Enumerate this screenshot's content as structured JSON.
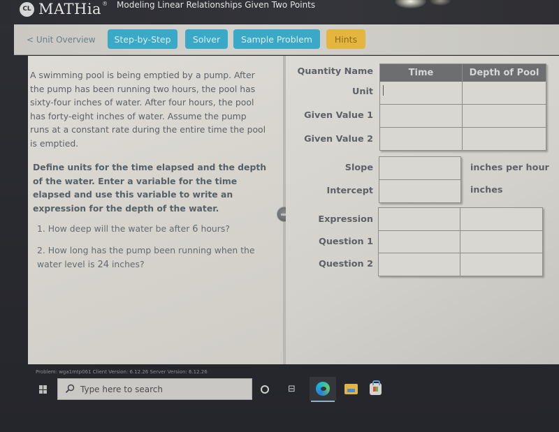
{
  "app": {
    "logo_badge": "CL",
    "logo_name": "MATHia",
    "logo_reg": "®",
    "lesson_title": "Modeling Linear Relationships Given Two Points"
  },
  "toolbar": {
    "back_link": "< Unit Overview",
    "buttons": [
      {
        "label": "Step-by-Step",
        "color": "#3aa8c7"
      },
      {
        "label": "Solver",
        "color": "#3aa8c7"
      },
      {
        "label": "Sample Problem",
        "color": "#3aa8c7"
      },
      {
        "label": "Hints",
        "color": "#e5b63d"
      }
    ]
  },
  "problem": {
    "scenario": "A swimming pool is being emptied by a pump. After the pump has been running two hours, the pool has sixty-four inches of water. After four hours, the pool has forty-eight inches of water. Assume the pump runs at a constant rate during the entire time the pool is emptied.",
    "instructions": "Define units for the time elapsed and the depth of the water. Enter a variable for the time elapsed and use this variable to write an expression for the depth of the water.",
    "questions": [
      {
        "number": "1.",
        "before": "How deep will the water be after ",
        "value": "6",
        "after": " hours?"
      },
      {
        "number": "2.",
        "before": "How long has the pump been running when the water level is ",
        "value": "24",
        "after": " inches?"
      }
    ]
  },
  "worksheet": {
    "row_labels": {
      "quantity_name": "Quantity Name",
      "unit": "Unit",
      "given_value_1": "Given Value 1",
      "given_value_2": "Given Value 2",
      "slope": "Slope",
      "intercept": "Intercept",
      "expression": "Expression",
      "question_1": "Question 1",
      "question_2": "Question 2"
    },
    "columns": [
      "Time",
      "Depth of Pool"
    ],
    "cells": {
      "unit_time": "",
      "unit_depth": "",
      "given1_time": "",
      "given1_depth": "",
      "given2_time": "",
      "given2_depth": "",
      "slope": "",
      "intercept": "",
      "expression_time": "",
      "expression_depth": "",
      "question1_time": "",
      "question1_depth": "",
      "question2_time": "",
      "question2_depth": ""
    },
    "slope_unit": "inches per hour",
    "intercept_unit": "inches"
  },
  "footer": {
    "info": "Problem: wga1mtp061   Client Version: 6.12.26   Server Version: 6.12.26"
  },
  "taskbar": {
    "search_placeholder": "Type here to search"
  }
}
